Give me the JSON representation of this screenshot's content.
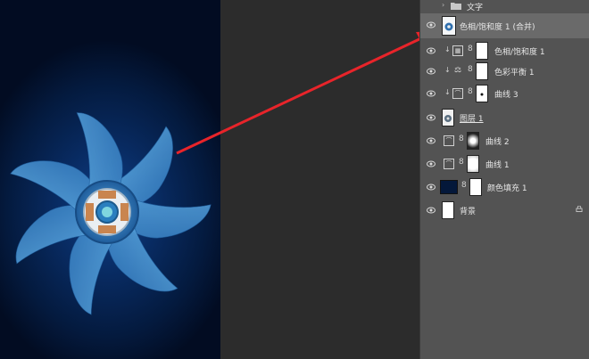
{
  "layers": {
    "group": {
      "name": "文字"
    },
    "items": [
      {
        "name": "色相/饱和度 1 (合并)",
        "selected": true
      },
      {
        "name": "色相/饱和度 1"
      },
      {
        "name": "色彩平衡 1"
      },
      {
        "name": "曲线 3"
      },
      {
        "name": "图层 1"
      },
      {
        "name": "曲线 2"
      },
      {
        "name": "曲线 1"
      },
      {
        "name": "颜色填充 1"
      },
      {
        "name": "背景"
      }
    ]
  },
  "colors": {
    "annotation_arrow": "#e8242a",
    "canvas_background": "#04183a",
    "fan_blade": "#3f8fd0",
    "panel_background": "#535353"
  }
}
